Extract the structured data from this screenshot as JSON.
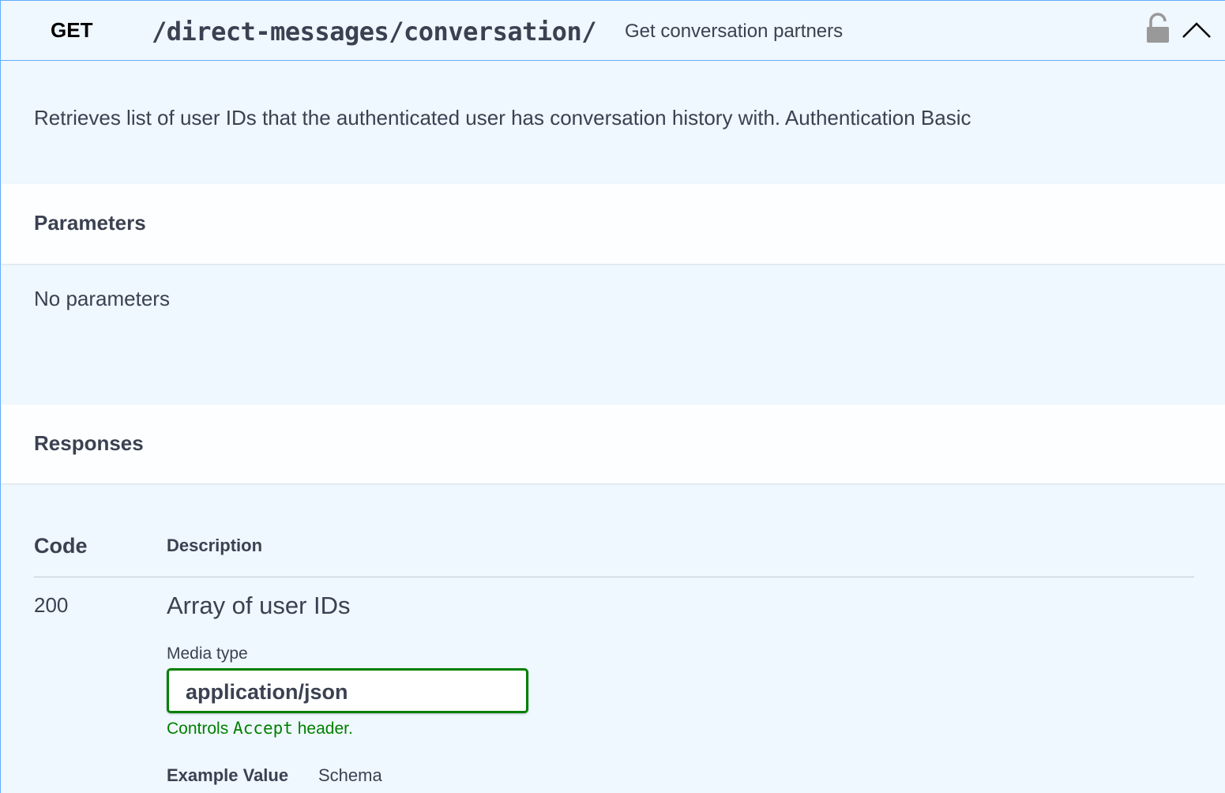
{
  "operation": {
    "method": "GET",
    "path": "/direct-messages/conversation/",
    "summary": "Get conversation partners",
    "description": "Retrieves list of user IDs that the authenticated user has conversation history with. Authentication Basic",
    "lock_icon": "lock-open-icon",
    "collapse_icon": "chevron-up-icon"
  },
  "parameters": {
    "title": "Parameters",
    "empty_text": "No parameters"
  },
  "responses": {
    "title": "Responses",
    "columns": {
      "code": "Code",
      "description": "Description"
    },
    "rows": [
      {
        "code": "200",
        "description": "Array of user IDs",
        "media_type_label": "Media type",
        "media_type_value": "application/json",
        "hint_prefix": "Controls",
        "hint_code": "Accept",
        "hint_suffix": "header.",
        "tabs": [
          "Example Value",
          "Schema"
        ]
      }
    ]
  },
  "colors": {
    "get_accent": "#61affe",
    "text": "#3b4151",
    "media_border": "#008000",
    "hint": "#008000"
  }
}
